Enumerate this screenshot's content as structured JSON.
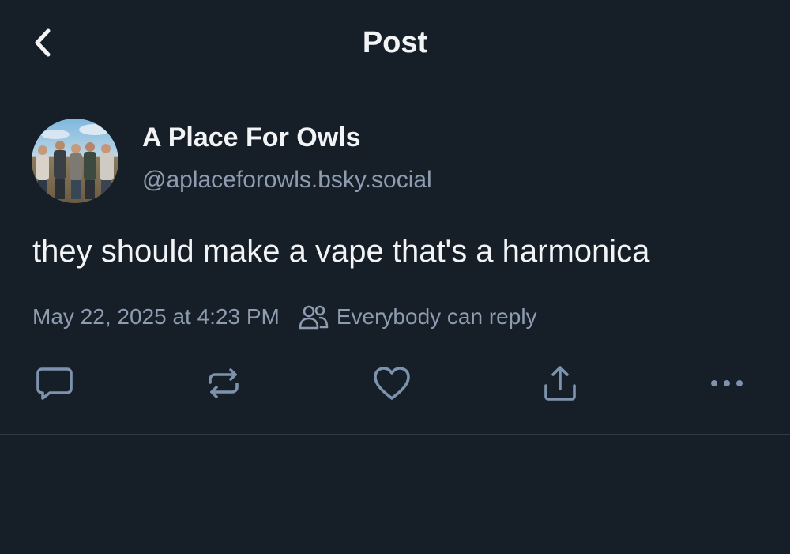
{
  "header": {
    "title": "Post",
    "back_icon": "chevron-left-icon"
  },
  "post": {
    "author_name": "A Place For Owls",
    "author_handle": "@aplaceforowls.bsky.social",
    "text": "they should make a vape that's a harmonica",
    "timestamp": "May 22, 2025 at 4:23 PM",
    "reply_setting": "Everybody can reply"
  },
  "actions": [
    {
      "name": "reply",
      "icon": "comment-icon"
    },
    {
      "name": "repost",
      "icon": "repost-icon"
    },
    {
      "name": "like",
      "icon": "heart-icon"
    },
    {
      "name": "share",
      "icon": "share-icon"
    },
    {
      "name": "more",
      "icon": "more-icon"
    }
  ],
  "colors": {
    "background": "#161e27",
    "text": "#f1f3f5",
    "muted": "#8d9cb0",
    "border": "#2e3a48"
  }
}
